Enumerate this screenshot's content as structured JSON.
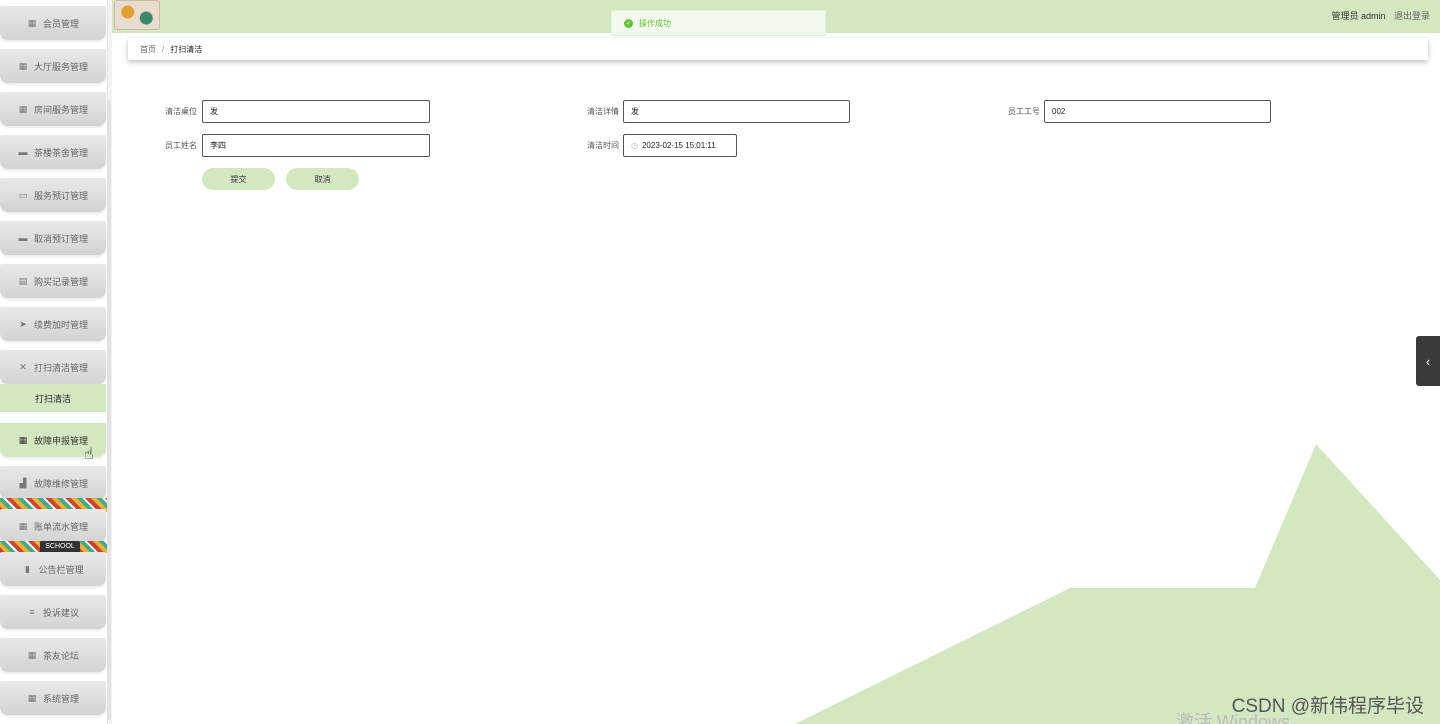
{
  "topbar": {
    "admin_label": "管理员 admin",
    "logout": "退出登录"
  },
  "toast": {
    "message": "操作成功"
  },
  "breadcrumb": {
    "home": "首页",
    "sep": "/",
    "current": "打扫清洁"
  },
  "sidebar": {
    "items": [
      {
        "label": "会员管理",
        "icon": "grid-icon"
      },
      {
        "label": "大厅服务管理",
        "icon": "grid-icon"
      },
      {
        "label": "房间服务管理",
        "icon": "grid-icon"
      },
      {
        "label": "茶楼茶舍管理",
        "icon": "comment-icon"
      },
      {
        "label": "服务预订管理",
        "icon": "print-icon"
      },
      {
        "label": "取消预订管理",
        "icon": "monitor-icon"
      },
      {
        "label": "购买记录管理",
        "icon": "clipboard-icon"
      },
      {
        "label": "续费加时管理",
        "icon": "plane-icon"
      },
      {
        "label": "打扫清洁管理",
        "icon": "ticket-icon"
      },
      {
        "label": "故障申报管理",
        "icon": "grid-icon"
      },
      {
        "label": "故障维修管理",
        "icon": "thumbs-up-icon"
      },
      {
        "label": "账单流水管理",
        "icon": "grid-dense-icon"
      },
      {
        "label": "公告栏管理",
        "icon": "bar-chart-icon"
      },
      {
        "label": "投诉建议",
        "icon": "list-icon"
      },
      {
        "label": "茶友论坛",
        "icon": "grid-icon"
      },
      {
        "label": "系统管理",
        "icon": "grid-icon"
      }
    ],
    "submenu": "打扫清洁",
    "school_badge": "SCHOOL"
  },
  "form": {
    "fields": [
      {
        "label": "清洁桌位",
        "value": "发"
      },
      {
        "label": "清洁详情",
        "value": "发"
      },
      {
        "label": "员工工号",
        "value": "002"
      },
      {
        "label": "员工姓名",
        "value": "李四"
      },
      {
        "label": "清洁时间",
        "value": "2023-02-15 15:01:11"
      }
    ],
    "submit": "提交",
    "cancel": "取消"
  },
  "watermark": "CSDN @新伟程序毕设",
  "activate_windows": "激活 Windows",
  "colors": {
    "accent": "#d3e7c1",
    "toast_green": "#67c23a"
  }
}
